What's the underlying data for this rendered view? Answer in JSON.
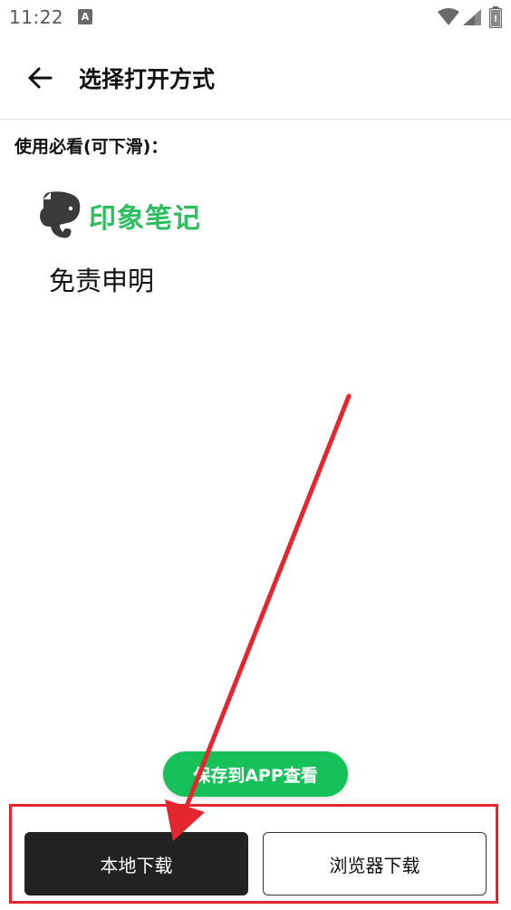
{
  "status_bar": {
    "time": "11:22",
    "notification_icon": "A",
    "icons": [
      "wifi-icon",
      "signal-icon",
      "battery-icon"
    ]
  },
  "app_bar": {
    "back_icon": "arrow-left-icon",
    "title": "选择打开方式"
  },
  "content": {
    "notice_heading": "使用必看(可下滑)：",
    "brand_logo": "evernote-elephant-icon",
    "brand_name": "印象笔记",
    "disclaimer": "免责申明"
  },
  "actions": {
    "save_to_app": "保存到APP查看",
    "local_download": "本地下载",
    "browser_download": "浏览器下载"
  },
  "colors": {
    "brand_green": "#2dbe60",
    "pill_green": "#16c15a",
    "annotation_red": "#e3262f",
    "dark_button": "#222222"
  }
}
